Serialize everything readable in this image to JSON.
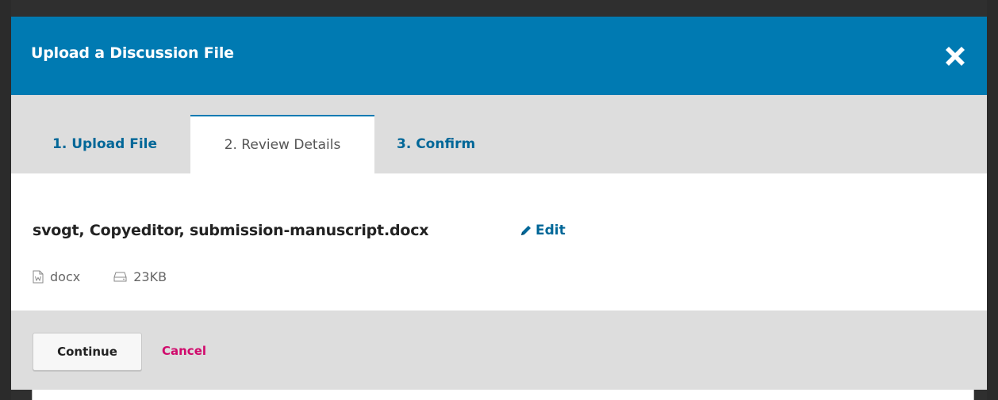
{
  "modal": {
    "title": "Upload a Discussion File",
    "close_label": "close"
  },
  "tabs": [
    {
      "label": "1. Upload File",
      "active": false
    },
    {
      "label": "2. Review Details",
      "active": true
    },
    {
      "label": "3. Confirm",
      "active": false
    }
  ],
  "file": {
    "name": "svogt, Copyeditor, submission-manuscript.docx",
    "edit_label": "Edit",
    "type": "docx",
    "size": "23KB"
  },
  "footer": {
    "continue_label": "Continue",
    "cancel_label": "Cancel"
  },
  "colors": {
    "header": "#007ab2",
    "link": "#006798",
    "cancel": "#d00a6c"
  },
  "icons": {
    "close": "close-icon",
    "edit": "pencil-icon",
    "file_type": "word-document-icon",
    "size": "hard-drive-icon"
  }
}
